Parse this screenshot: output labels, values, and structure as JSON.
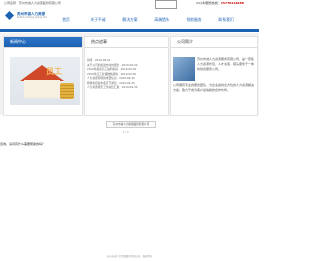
{
  "topbar": {
    "welcome": "公司名称 · 苏州市诚人力资源股份有限公司",
    "search_placeholder": "",
    "phone_label": "24小时服务热线：",
    "phone_number": "15770418288"
  },
  "header": {
    "logo_name": "苏州市诚人力资源",
    "logo_sub": "Suzhou Cheng Group Ltd"
  },
  "nav": [
    "首页",
    "关于平诚",
    "解决方案",
    "高端猎头",
    "领航服务",
    "联系我们"
  ],
  "panels": {
    "left_title": "新闻中心",
    "left_image_word": "员工",
    "middle_title": "热点追事",
    "middle_news": [
      "新闻 · 2019-09-01",
      "关于公司的发展方向的报告 · 2019-09-30",
      "2019年最新员工福利指南 · 2019-09-30",
      "2019年员工社保缴纳通知 · 2019-09-30",
      "人力资源管理的重要知识 · 2019-09-30",
      "微博新闻发布会召开通知 · 2019-09-30",
      "人力资源服务工作总结汇报 · 2019-09-30"
    ],
    "right_title": "公司简介",
    "about_text": "苏州市诚人力资源服务有限公司，是一家集人力资源外包、人才派遣、猎头服务于一体的综合服务公司。",
    "about_text_2": "公司拥有专业的服务团队，为企业提供全方位的人力资源解决方案，致力于成为客户最信赖的合作伙伴。"
  },
  "bottom": {
    "link": "苏州市诚人力资源股份有限公司",
    "code": "1 / 1",
    "question": "咨询，请问有什么需要帮助的吗？",
    "footer": "苏州市诚人力资源股份有限公司 · 版权所有"
  },
  "colors": {
    "brand": "#1b62b3",
    "accent": "#cc0000"
  }
}
